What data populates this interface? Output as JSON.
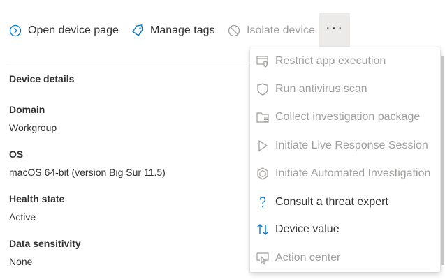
{
  "toolbar": {
    "open_device_page": "Open device page",
    "manage_tags": "Manage tags",
    "isolate_device": "Isolate device",
    "more_icon": "ellipsis-icon"
  },
  "details": {
    "title": "Device details",
    "fields": [
      {
        "label": "Domain",
        "value": "Workgroup"
      },
      {
        "label": "OS",
        "value": "macOS 64-bit (version Big Sur 11.5)"
      },
      {
        "label": "Health state",
        "value": "Active"
      },
      {
        "label": "Data sensitivity",
        "value": "None"
      }
    ]
  },
  "menu": {
    "items": [
      {
        "label": "Restrict app execution",
        "icon": "restrict-app-icon",
        "enabled": false
      },
      {
        "label": "Run antivirus scan",
        "icon": "shield-icon",
        "enabled": false
      },
      {
        "label": "Collect investigation package",
        "icon": "folder-package-icon",
        "enabled": false
      },
      {
        "label": "Initiate Live Response Session",
        "icon": "play-icon",
        "enabled": false
      },
      {
        "label": "Initiate Automated Investigation",
        "icon": "hexagon-icon",
        "enabled": false
      },
      {
        "label": "Consult a threat expert",
        "icon": "question-icon",
        "enabled": true
      },
      {
        "label": "Device value",
        "icon": "sort-arrows-icon",
        "enabled": true
      },
      {
        "label": "Action center",
        "icon": "action-center-icon",
        "enabled": false
      }
    ]
  },
  "colors": {
    "accent": "#0078d4",
    "text": "#323130",
    "disabled": "#a19f9d",
    "more_button_bg": "#edebe9"
  }
}
